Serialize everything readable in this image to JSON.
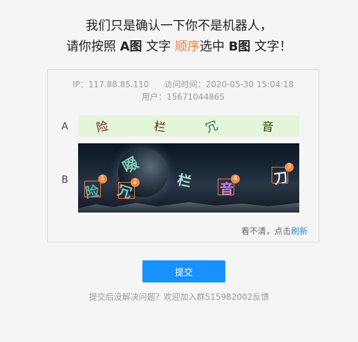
{
  "heading": {
    "line1": "我们只是确认一下你不是机器人，",
    "line2_prefix": "请你按照",
    "line2_a": "A图",
    "line2_mid1": "文字",
    "line2_order": "顺序",
    "line2_mid2": "选中",
    "line2_b": "B图",
    "line2_suffix": "文字！"
  },
  "info": {
    "ip": "IP：117.88.85.110",
    "visit_time": "访问时间：2020-05-30 15:04:18",
    "user": "用户：15671044865"
  },
  "rows": {
    "a_label": "A",
    "b_label": "B"
  },
  "sequence_chars": [
    {
      "char": "险",
      "color": "#7a1428"
    },
    {
      "char": "栏",
      "color": "#5a2814"
    },
    {
      "char": "冗",
      "color": "#1f6a4a"
    },
    {
      "char": "音",
      "color": "#3a3a10"
    }
  ],
  "captcha_chars": [
    {
      "char": "啜",
      "color": "#7fd0b8"
    },
    {
      "char": "险",
      "color": "#5fb0a8"
    },
    {
      "char": "冗",
      "color": "#7ec8c0"
    },
    {
      "char": "栏",
      "color": "#a8e0d0"
    },
    {
      "char": "音",
      "color": "#c880e8"
    },
    {
      "char": "刀",
      "color": "#e8e8f0"
    }
  ],
  "markers": [
    "1",
    "2",
    "3",
    "4"
  ],
  "refresh": {
    "text": "看不清，点击",
    "link": "刷新"
  },
  "submit_label": "提交",
  "footer": "提交后没解决问题？欢迎加入群515982002反馈"
}
